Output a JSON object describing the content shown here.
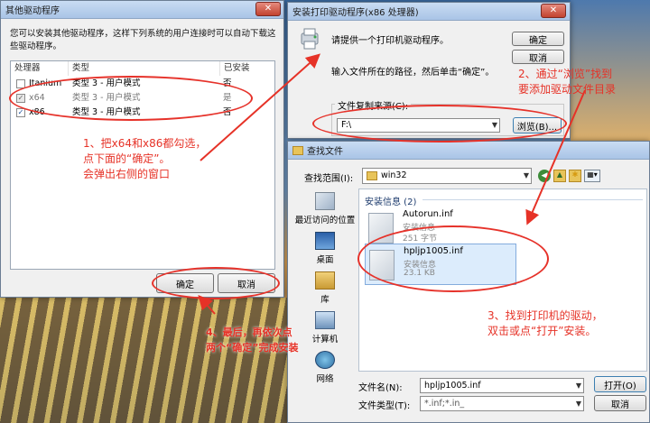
{
  "left_window": {
    "title": "其他驱动程序",
    "description": "您可以安装其他驱动程序，这样下列系统的用户连接时可以自动下载这些驱动程序。",
    "columns": [
      "处理器",
      "类型",
      "已安装"
    ],
    "rows": [
      {
        "processor": "Itanium",
        "type": "类型 3 - 用户模式",
        "installed": "否",
        "checked": false
      },
      {
        "processor": "x64",
        "type": "类型 3 - 用户模式",
        "installed": "是",
        "checked": true
      },
      {
        "processor": "x86",
        "type": "类型 3 - 用户模式",
        "installed": "否",
        "checked": true
      }
    ],
    "ok_label": "确定",
    "cancel_label": "取消"
  },
  "install_window": {
    "title": "安装打印驱动程序(x86 处理器)",
    "heading": "请提供一个打印机驱动程序。",
    "instruction": "输入文件所在的路径，然后单击“确定”。",
    "ok_label": "确定",
    "cancel_label": "取消",
    "copy_from_label": "文件复制来源(C):",
    "path_value": "F:\\",
    "browse_label": "浏览(B)..."
  },
  "file_dialog": {
    "title": "查找文件",
    "lookin_label": "查找范围(I):",
    "lookin_value": "win32",
    "group_label": "安装信息 (2)",
    "places": [
      "最近访问的位置",
      "桌面",
      "库",
      "计算机",
      "网络"
    ],
    "files": [
      {
        "name": "Autorun.inf",
        "type": "安装信息",
        "size": "251 字节"
      },
      {
        "name": "hpljp1005.inf",
        "type": "安装信息",
        "size": "23.1 KB"
      }
    ],
    "filename_label": "文件名(N):",
    "filename_value": "hpljp1005.inf",
    "filetype_label": "文件类型(T):",
    "filetype_value": "*.inf;*.in_",
    "open_label": "打开(O)",
    "cancel_label": "取消"
  },
  "annotations": {
    "step1": [
      "1、把x64和x86都勾选，",
      "点下面的“确定”。",
      "会弹出右侧的窗口"
    ],
    "step2": [
      "2、通过“浏览”找到",
      "要添加驱动文件目录"
    ],
    "step3": [
      "3、找到打印机的驱动，",
      "双击或点“打开”安装。"
    ],
    "step4": [
      "4、最后，再依次点",
      "两个“确定”完成安装"
    ],
    "color": "#e63227"
  },
  "icons": {
    "close": "close-icon",
    "printer": "printer-icon",
    "folder": "folder-icon",
    "back": "back-icon",
    "up": "up-folder-icon",
    "new_folder": "new-folder-icon",
    "views": "views-icon",
    "inf_file": "inf-file-icon"
  }
}
